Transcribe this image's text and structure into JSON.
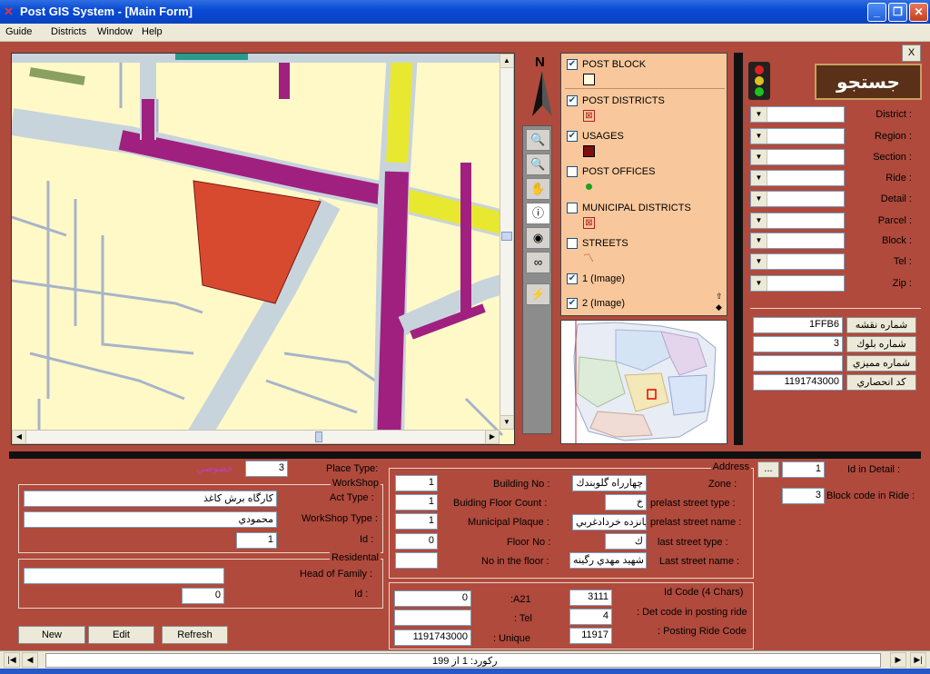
{
  "window": {
    "title": "Post GIS System - [Main Form]"
  },
  "menu": [
    "Guide",
    "Districts",
    "Window",
    "Help"
  ],
  "north_label": "N",
  "layers": [
    {
      "name": "POST BLOCK",
      "checked": true
    },
    {
      "name": "POST DISTRICTS",
      "checked": true
    },
    {
      "name": "USAGES",
      "checked": true
    },
    {
      "name": "POST OFFICES",
      "checked": false
    },
    {
      "name": "MUNICIPAL DISTRICTS",
      "checked": false
    },
    {
      "name": "STREETS",
      "checked": false
    },
    {
      "name": "1 (Image)",
      "checked": true
    },
    {
      "name": "2 (Image)",
      "checked": true
    }
  ],
  "search": {
    "button_label": "جستجو",
    "close_label": "X",
    "fields": [
      "District :",
      "Region :",
      "Section :",
      "Ride :",
      "Detail :",
      "Parcel :",
      "Block :",
      "Tel :",
      "Zip :"
    ]
  },
  "info": [
    {
      "label": "شماره نقشه",
      "value": "1FFB6"
    },
    {
      "label": "شماره بلوك",
      "value": "3"
    },
    {
      "label": "شماره مميزي",
      "value": ""
    },
    {
      "label": "كد انحصاري",
      "value": "1191743000"
    }
  ],
  "place": {
    "label": "Place Type:",
    "value": "3",
    "type_text": "خصوصي"
  },
  "workshop": {
    "title": "WorkShop",
    "act_type_label": "Act Type :",
    "act_type_value": "كارگاه برش كاغذ",
    "type_label": "WorkShop Type :",
    "type_value": "محمودي",
    "id_label": "Id :",
    "id_value": "1"
  },
  "residental": {
    "title": "Residental",
    "head_label": "Head of Family :",
    "head_value": "",
    "id_label": "Id :",
    "id_value": "0"
  },
  "address": {
    "title": "Address",
    "building_no_label": "Building No :",
    "building_no": "1",
    "floor_count_label": "Buiding Floor Count :",
    "floor_count": "1",
    "plaque_label": "Municipal Plaque :",
    "plaque": "1",
    "floor_no_label": "Floor No :",
    "floor_no": "0",
    "no_in_floor_label": "No in the floor :",
    "no_in_floor": "",
    "zone_label": "Zone :",
    "zone": "چهارراه گلوبندك",
    "prelast_type_label": "prelast street type :",
    "prelast_type": "خ",
    "prelast_name_label": "prelast street name :",
    "prelast_name": "پانزده خردادغربي",
    "last_type_label": "last street type :",
    "last_type": "ك",
    "last_name_label": "Last street name :",
    "last_name": "شهيد مهدي رگينه"
  },
  "ids": {
    "id_detail_label": "Id in Detail :",
    "id_detail": "1",
    "ellipsis": "...",
    "block_ride_label": "Block code in Ride :",
    "block_ride": "3"
  },
  "codes": {
    "a21_label": ":A21",
    "a21": "0",
    "tel_label": ": Tel",
    "tel": "",
    "unique_label": ": Unique",
    "unique": "1191743000",
    "idcode_label": "Id Code (4 Chars)",
    "idcode": "3111",
    "det_code_label": ": Det code in posting ride",
    "det_code": "4",
    "posting_label": ": Posting Ride Code",
    "posting": "11917"
  },
  "buttons": {
    "new": "New",
    "edit": "Edit",
    "refresh": "Refresh"
  },
  "status": {
    "record_text": "ركورد:  1 از 199"
  }
}
